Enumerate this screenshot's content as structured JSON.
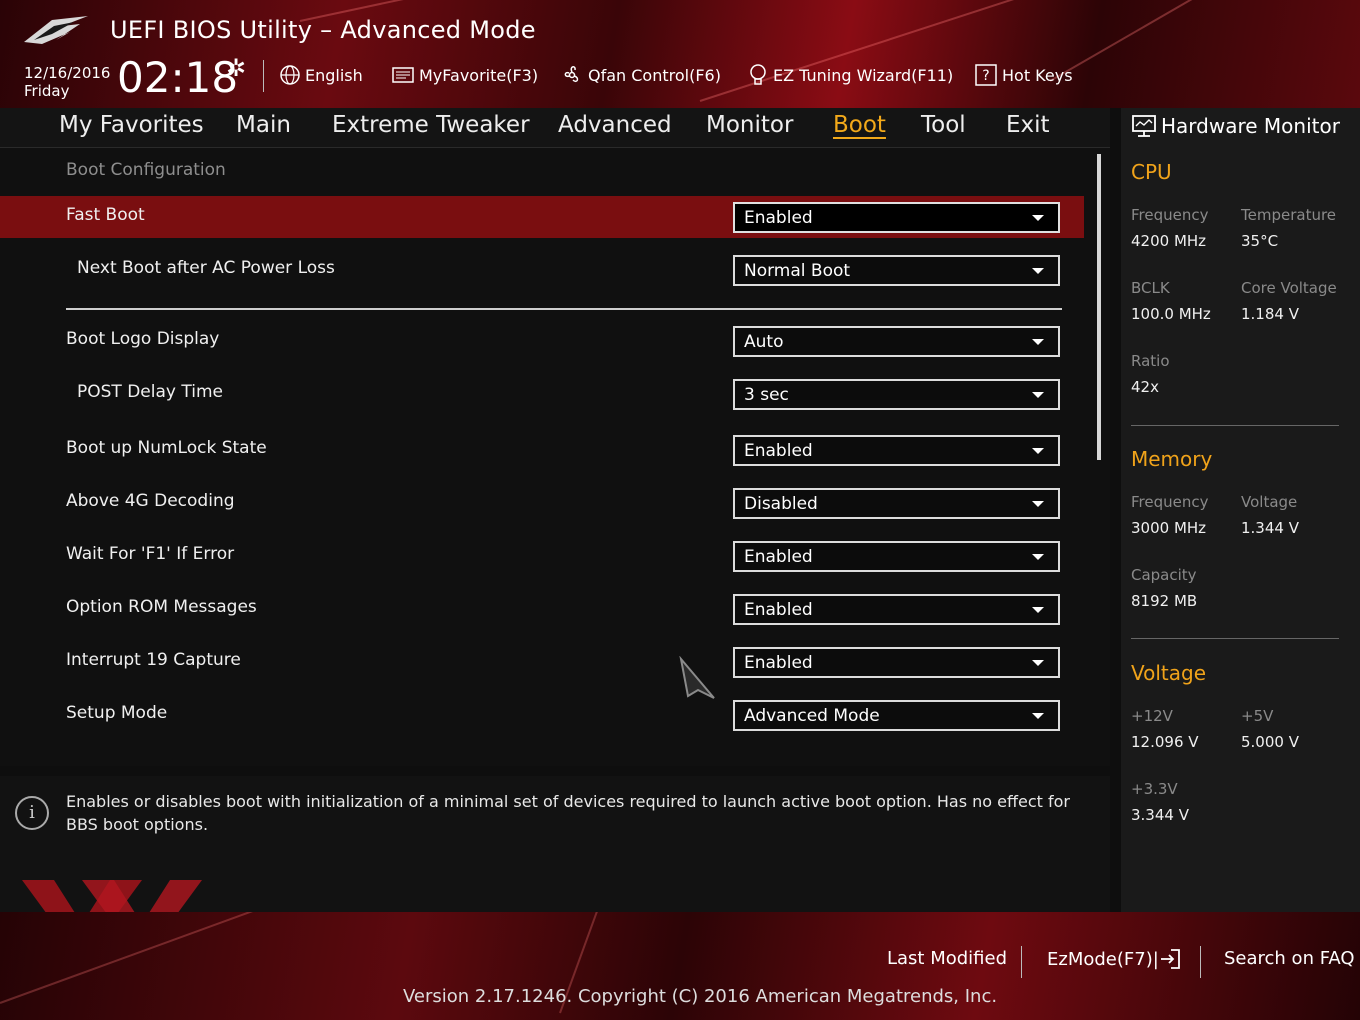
{
  "header": {
    "title": "UEFI BIOS Utility – Advanced Mode",
    "date": "12/16/2016",
    "day": "Friday",
    "time": "02:18",
    "toolbar": [
      {
        "label": "English",
        "icon": "globe-icon"
      },
      {
        "label": "MyFavorite(F3)",
        "icon": "favorite-icon"
      },
      {
        "label": "Qfan Control(F6)",
        "icon": "fan-icon"
      },
      {
        "label": "EZ Tuning Wizard(F11)",
        "icon": "bulb-icon"
      },
      {
        "label": "Hot Keys",
        "icon": "help-icon"
      }
    ]
  },
  "nav": {
    "tabs": [
      "My Favorites",
      "Main",
      "Extreme Tweaker",
      "Advanced",
      "Monitor",
      "Boot",
      "Tool",
      "Exit"
    ],
    "active": "Boot"
  },
  "main": {
    "section_title": "Boot Configuration",
    "settings": [
      {
        "label": "Fast Boot",
        "value": "Enabled",
        "selected": true
      },
      {
        "label": "Next Boot after AC Power Loss",
        "value": "Normal Boot"
      },
      {
        "label": "Boot Logo Display",
        "value": "Auto"
      },
      {
        "label": "POST Delay Time",
        "value": "3 sec"
      },
      {
        "label": "Boot up NumLock State",
        "value": "Enabled"
      },
      {
        "label": "Above 4G Decoding",
        "value": "Disabled"
      },
      {
        "label": "Wait For 'F1' If Error",
        "value": "Enabled"
      },
      {
        "label": "Option ROM Messages",
        "value": "Enabled"
      },
      {
        "label": "Interrupt 19 Capture",
        "value": "Enabled"
      },
      {
        "label": "Setup Mode",
        "value": "Advanced Mode"
      }
    ]
  },
  "info": {
    "text": "Enables or disables boot with initialization of a minimal set of devices required to launch active boot option. Has no effect for BBS boot options."
  },
  "hardware_monitor": {
    "title": "Hardware Monitor",
    "cpu": {
      "heading": "CPU",
      "frequency_label": "Frequency",
      "frequency": "4200 MHz",
      "temperature_label": "Temperature",
      "temperature": "35°C",
      "bclk_label": "BCLK",
      "bclk": "100.0 MHz",
      "core_voltage_label": "Core Voltage",
      "core_voltage": "1.184 V",
      "ratio_label": "Ratio",
      "ratio": "42x"
    },
    "memory": {
      "heading": "Memory",
      "frequency_label": "Frequency",
      "frequency": "3000 MHz",
      "voltage_label": "Voltage",
      "voltage": "1.344 V",
      "capacity_label": "Capacity",
      "capacity": "8192 MB"
    },
    "voltage": {
      "heading": "Voltage",
      "v12_label": "+12V",
      "v12": "12.096 V",
      "v5_label": "+5V",
      "v5": "5.000 V",
      "v33_label": "+3.3V",
      "v33": "3.344 V"
    }
  },
  "footer": {
    "last_modified": "Last Modified",
    "ezmode": "EzMode(F7)|",
    "search": "Search on FAQ",
    "version": "Version 2.17.1246. Copyright (C) 2016 American Megatrends, Inc."
  },
  "colors": {
    "accent": "#f2a91a",
    "selected_row": "#7a0e10",
    "header_red": "#8a0c14"
  }
}
